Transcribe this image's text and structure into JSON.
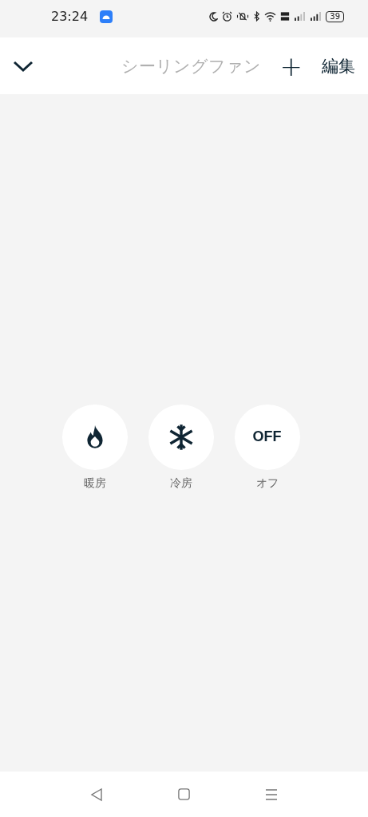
{
  "status_bar": {
    "time": "23:24",
    "battery": "39"
  },
  "header": {
    "title": "シーリングファン",
    "add": "+",
    "edit": "編集"
  },
  "modes": [
    {
      "kind": "heat",
      "label": "暖房"
    },
    {
      "kind": "cool",
      "label": "冷房"
    },
    {
      "kind": "text",
      "text": "OFF",
      "label": "オフ"
    }
  ]
}
